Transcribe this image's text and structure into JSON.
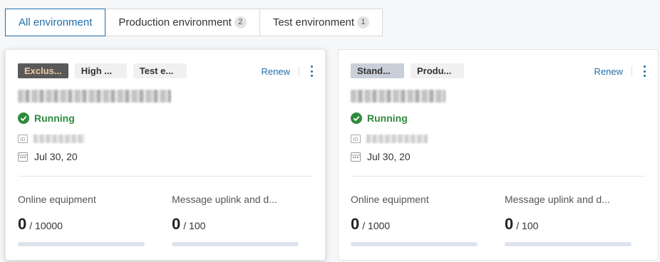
{
  "tabs": [
    {
      "label": "All environment",
      "count": null
    },
    {
      "label": "Production environment",
      "count": "2"
    },
    {
      "label": "Test environment",
      "count": "1"
    }
  ],
  "cards": [
    {
      "tags": [
        "Exclus...",
        "High ...",
        "Test e..."
      ],
      "renew": "Renew",
      "status": "Running",
      "date": "Jul 30, 20",
      "metrics": [
        {
          "label": "Online equipment",
          "value": "0",
          "limit": "/ 10000",
          "progress": 0
        },
        {
          "label": "Message uplink and d...",
          "value": "0",
          "limit": "/ 100",
          "progress": 0
        }
      ]
    },
    {
      "tags": [
        "Stand...",
        "Produ..."
      ],
      "renew": "Renew",
      "status": "Running",
      "date": "Jul 30, 20",
      "metrics": [
        {
          "label": "Online equipment",
          "value": "0",
          "limit": "/ 1000",
          "progress": 0
        },
        {
          "label": "Message uplink and d...",
          "value": "0",
          "limit": "/ 100",
          "progress": 0
        }
      ]
    }
  ],
  "colors": {
    "accent": "#1f6fa8",
    "running": "#2e8b3e",
    "tag_dark": "#595959",
    "tag_dark_text": "#f0c9a0"
  },
  "icons": {
    "status": "check-circle-icon",
    "id": "id-card-icon",
    "date": "calendar-icon",
    "more": "more-vertical-icon"
  }
}
